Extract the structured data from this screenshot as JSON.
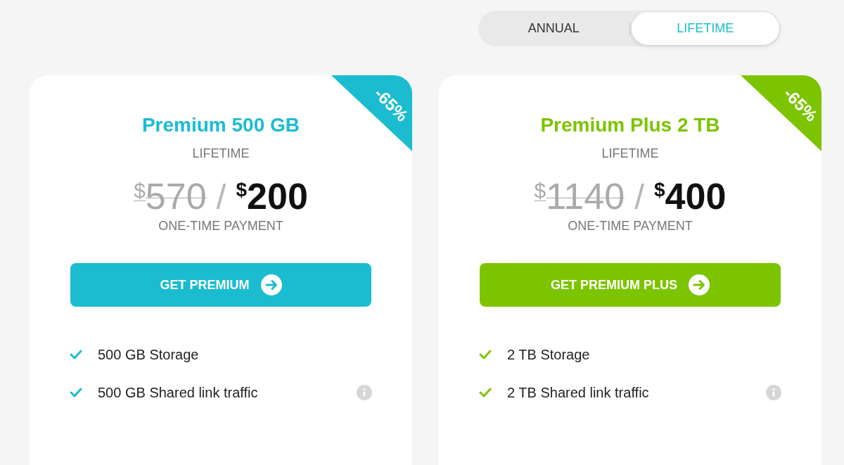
{
  "billing_toggle": [
    {
      "label": "ANNUAL",
      "selected": false
    },
    {
      "label": "LIFETIME",
      "selected": true
    }
  ],
  "plans": [
    {
      "color": "#1bbccf",
      "badge": "-65%",
      "name": "Premium 500 GB",
      "term": "LIFETIME",
      "old_price": {
        "currency": "$",
        "amount": "570"
      },
      "separator": "/",
      "new_price": {
        "currency": "$",
        "amount": "200"
      },
      "payment_note": "ONE-TIME PAYMENT",
      "button": "GET PREMIUM",
      "features": [
        {
          "text": "500 GB Storage",
          "info": false
        },
        {
          "text": "500 GB Shared link traffic",
          "info": true
        }
      ]
    },
    {
      "color": "#7dc400",
      "badge": "-65%",
      "name": "Premium Plus 2 TB",
      "term": "LIFETIME",
      "old_price": {
        "currency": "$",
        "amount": "1140"
      },
      "separator": "/",
      "new_price": {
        "currency": "$",
        "amount": "400"
      },
      "payment_note": "ONE-TIME PAYMENT",
      "button": "GET PREMIUM PLUS",
      "features": [
        {
          "text": "2 TB Storage",
          "info": false
        },
        {
          "text": "2 TB Shared link traffic",
          "info": true
        }
      ]
    }
  ]
}
